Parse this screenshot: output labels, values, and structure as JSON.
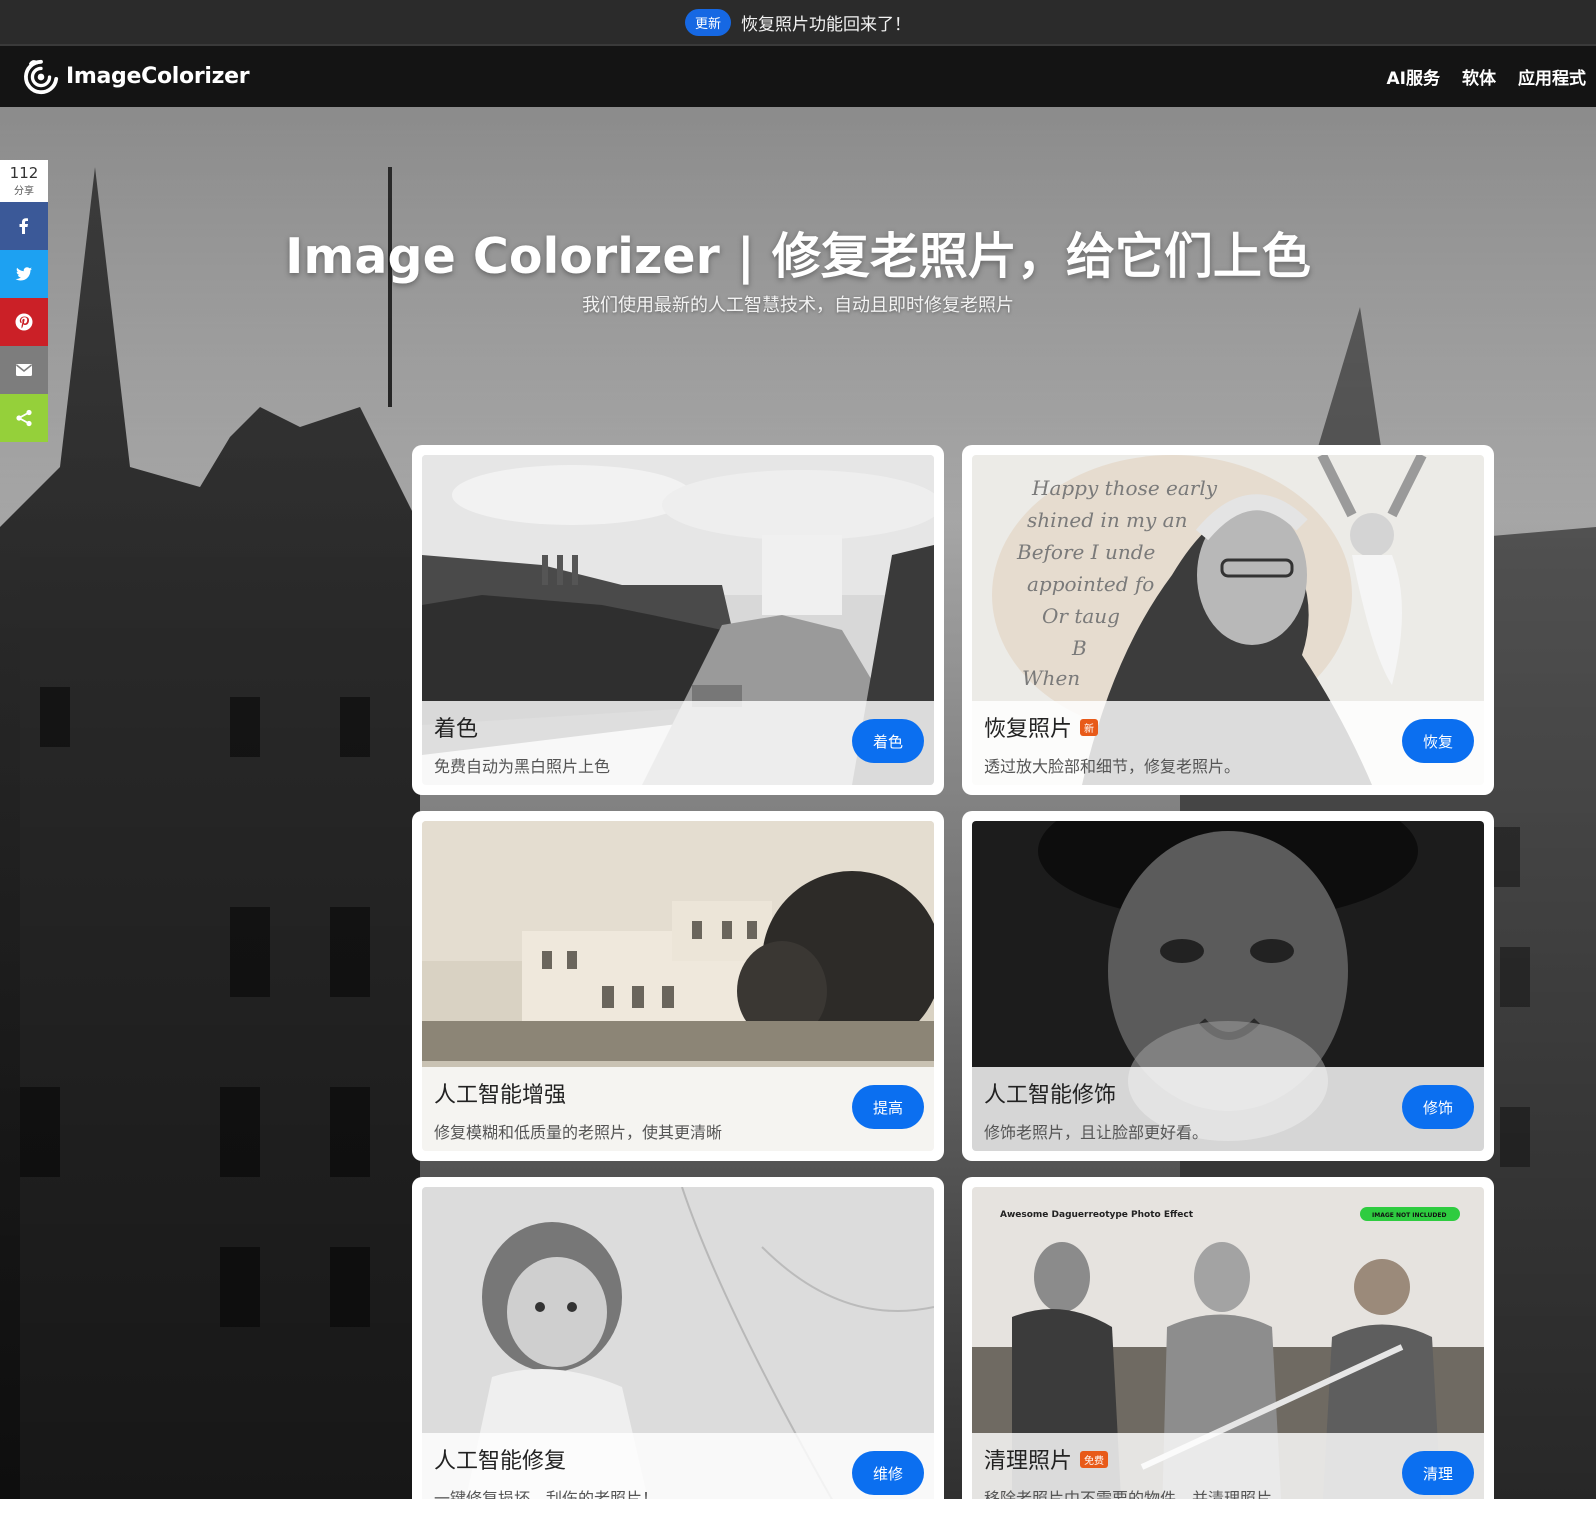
{
  "announcement": {
    "badge": "更新",
    "text": "恢复照片功能回来了！"
  },
  "header": {
    "logo_text": "ImageColorizer",
    "nav": [
      "AI服务",
      "软体",
      "应用程式"
    ]
  },
  "hero": {
    "title": "Image Colorizer | 修复老照片，给它们上色",
    "subtitle": "我们使用最新的人工智慧技术，自动且即时修复老照片"
  },
  "share": {
    "count": "112",
    "label": "分享",
    "buttons": [
      {
        "name": "facebook",
        "color": "#3b5998"
      },
      {
        "name": "twitter",
        "color": "#1da1f2"
      },
      {
        "name": "pinterest",
        "color": "#cb2027"
      },
      {
        "name": "email",
        "color": "#7d7d7d"
      },
      {
        "name": "share",
        "color": "#95d03a"
      }
    ]
  },
  "cards": [
    {
      "title": "着色",
      "desc": "免费自动为黑白照片上色",
      "button": "着色",
      "tag": ""
    },
    {
      "title": "恢复照片",
      "desc": "透过放大脸部和细节，修复老照片。",
      "button": "恢复",
      "tag": "新"
    },
    {
      "title": "人工智能增强",
      "desc": "修复模糊和低质量的老照片，使其更清晰",
      "button": "提高",
      "tag": ""
    },
    {
      "title": "人工智能修饰",
      "desc": "修饰老照片，且让脸部更好看。",
      "button": "修饰",
      "tag": ""
    },
    {
      "title": "人工智能修复",
      "desc": "一键修复损坏、刮伤的老照片！",
      "button": "维修",
      "tag": ""
    },
    {
      "title": "清理照片",
      "desc": "移除老照片中不需要的物件，并清理照片。",
      "button": "清理",
      "tag": "免费"
    }
  ],
  "card_image_texts": {
    "poem": [
      "Happy those early",
      "shined in my an",
      "Before I unde",
      "appointed fo",
      "Or taug",
      "B",
      "When"
    ],
    "daguerreotype_label": "Awesome Daguerreotype Photo Effect",
    "image_not_included": "IMAGE NOT INCLUDED"
  },
  "colors": {
    "accent": "#0b6ff0",
    "header_bg": "#141414",
    "announce_bg": "#2b2b2b"
  }
}
